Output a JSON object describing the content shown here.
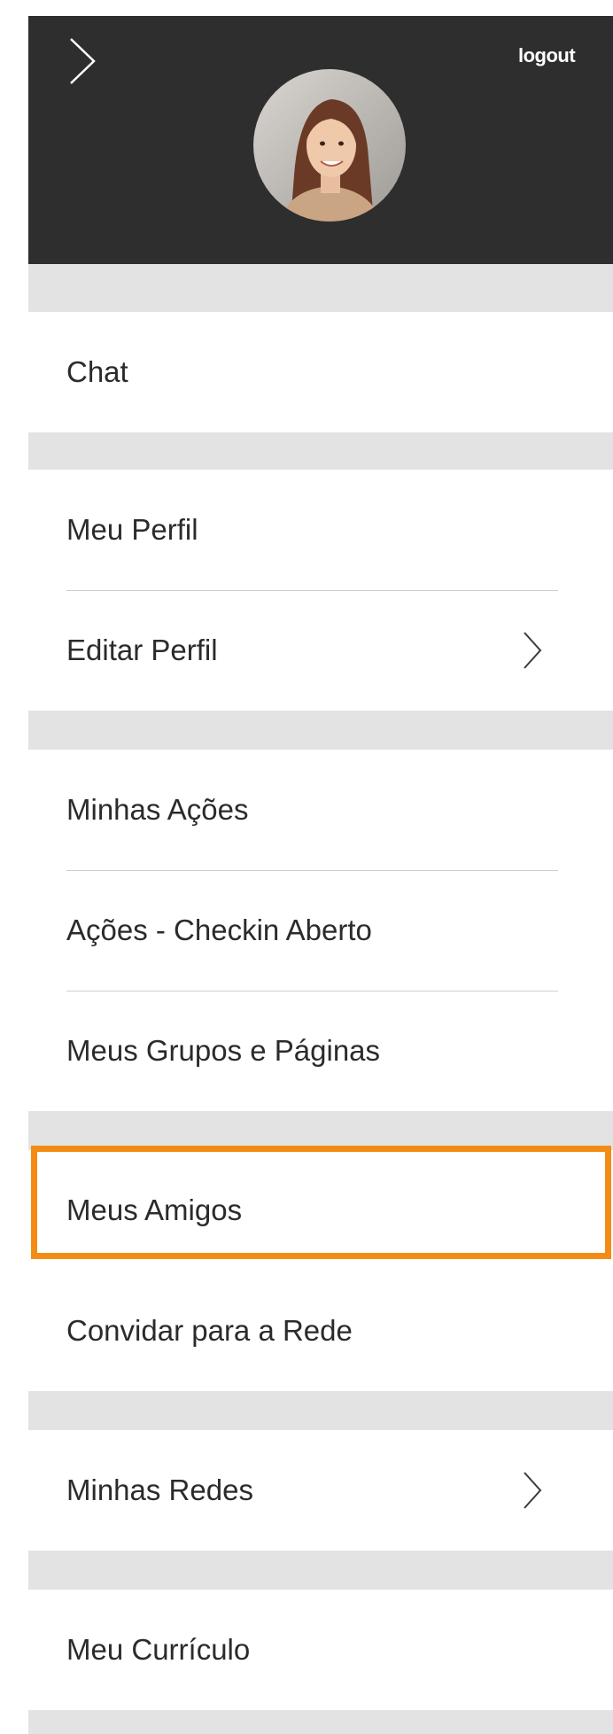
{
  "header": {
    "logout_label": "logout",
    "back_icon": "chevron-right-icon",
    "avatar": "user-avatar"
  },
  "menu": {
    "chat": "Chat",
    "meu_perfil": "Meu Perfil",
    "editar_perfil": "Editar Perfil",
    "minhas_acoes": "Minhas Ações",
    "acoes_checkin": "Ações - Checkin Aberto",
    "meus_grupos": "Meus Grupos e Páginas",
    "meus_amigos": "Meus Amigos",
    "convidar": "Convidar para a Rede",
    "minhas_redes": "Minhas Redes",
    "meu_curriculo": "Meu Currículo"
  },
  "colors": {
    "header_bg": "#2e2e2e",
    "page_bg": "#e3e3e3",
    "highlight": "#f28c14",
    "text": "#2b2b2b"
  }
}
